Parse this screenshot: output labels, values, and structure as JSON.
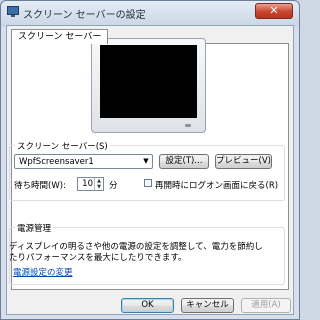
{
  "window": {
    "title": "スクリーン セーバーの設定",
    "close_glyph": "✕"
  },
  "tabs": [
    {
      "label": "スクリーン セーバー"
    }
  ],
  "screensaver": {
    "group_label": "スクリーン セーバー(S)",
    "selected": "WpfScreensaver1",
    "settings_label": "設定(T)...",
    "preview_label": "プレビュー(V)",
    "wait_label": "待ち時間(W):",
    "wait_value": "10",
    "wait_unit": "分",
    "resume_label": "再開時にログオン画面に戻る(R)",
    "resume_checked": false
  },
  "power": {
    "group_label": "電源管理",
    "description": "ディスプレイの明るさや他の電源の設定を調整して、電力を節約したりパフォーマンスを最大にしたりできます。",
    "link": "電源設定の変更"
  },
  "buttons": {
    "ok": "OK",
    "cancel": "キャンセル",
    "apply": "適用(A)"
  },
  "icons": {
    "title": "screen-saver-settings-icon",
    "close": "close-icon",
    "dropdown": "chevron-down-icon"
  }
}
